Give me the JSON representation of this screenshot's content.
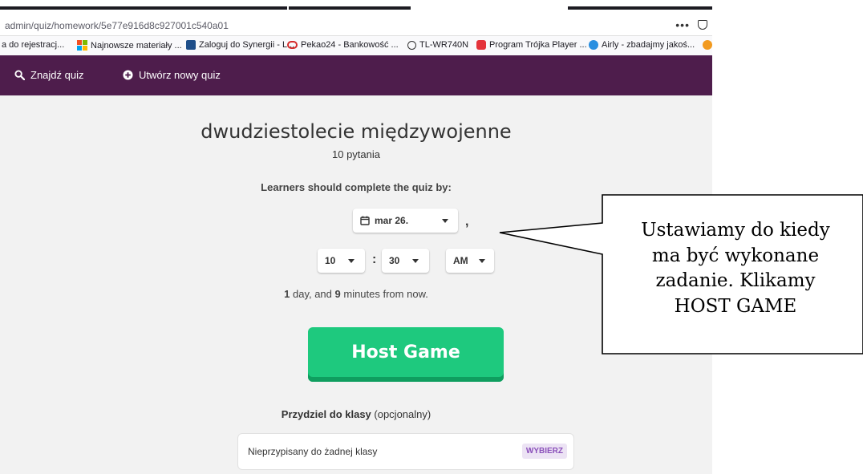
{
  "browser": {
    "url": "admin/quiz/homework/5e77e916d8c927001c540a01",
    "more_label": "•••",
    "bookmarks": [
      {
        "label": "a do rejestracj...",
        "icon": "none"
      },
      {
        "label": "Najnowsze materiały ...",
        "icon": "windows-icon"
      },
      {
        "label": "Zaloguj do Synergii - L...",
        "icon": "librus-icon"
      },
      {
        "label": "Pekao24 - Bankowość ...",
        "icon": "pekao-icon"
      },
      {
        "label": "TL-WR740N",
        "icon": "globe-icon"
      },
      {
        "label": "Program Trójka Player ...",
        "icon": "radio-icon"
      },
      {
        "label": "Airly - zbadajmy jakoś...",
        "icon": "airly-icon"
      }
    ]
  },
  "nav": {
    "find_quiz": "Znajdź quiz",
    "create_quiz": "Utwórz nowy quiz"
  },
  "quiz": {
    "title": "dwudziestolecie międzywojenne",
    "question_count": "10 pytania",
    "deadline_label": "Learners should complete the quiz by:",
    "date_value": "mar 26.",
    "date_separator": ",",
    "hour_value": "10",
    "time_separator": ":",
    "minute_value": "30",
    "ampm_value": "AM",
    "relative_days": "1",
    "relative_mid": " day, and ",
    "relative_minutes": "9",
    "relative_end": " minutes from now.",
    "host_button": "Host Game",
    "class_label": "Przydziel do klasy",
    "class_label_optional": " (opcjonalny)",
    "class_placeholder": "Nieprzypisany do żadnej klasy",
    "choose_button": "WYBIERZ"
  },
  "callout": {
    "lines": [
      "Ustawiamy do kiedy",
      "ma być wykonane",
      "zadanie. Klikamy",
      "HOST GAME"
    ]
  },
  "colors": {
    "navbar": "#4e1d4c",
    "host_button": "#1ec97e",
    "choose_button_text": "#8a4fba"
  }
}
